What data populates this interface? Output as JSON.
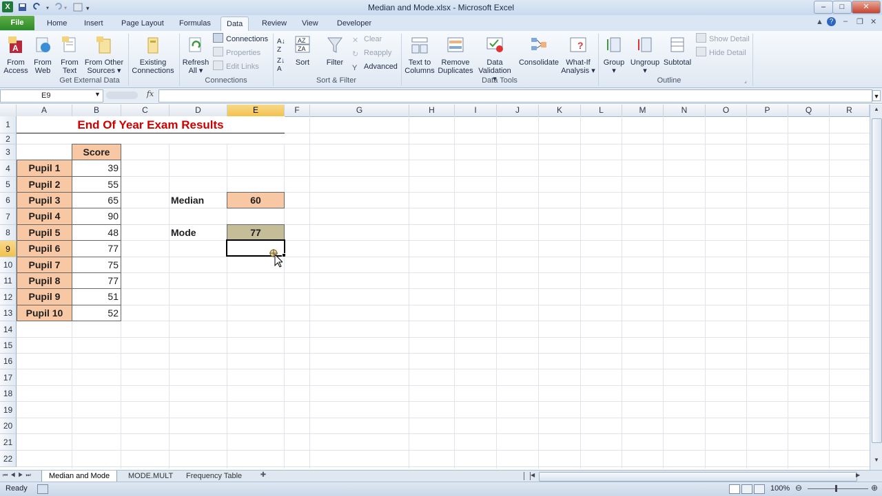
{
  "window": {
    "title": "Median and Mode.xlsx  -  Microsoft Excel"
  },
  "tabs": [
    "File",
    "Home",
    "Insert",
    "Page Layout",
    "Formulas",
    "Data",
    "Review",
    "View",
    "Developer"
  ],
  "active_tab": "Data",
  "ribbon": {
    "get_external": {
      "group_label": "Get External Data",
      "from_access": [
        "From",
        "Access"
      ],
      "from_web": [
        "From",
        "Web"
      ],
      "from_text": [
        "From",
        "Text"
      ],
      "from_other": [
        "From Other",
        "Sources ▾"
      ],
      "existing": [
        "Existing",
        "Connections"
      ]
    },
    "connections": {
      "group_label": "Connections",
      "refresh": [
        "Refresh",
        "All ▾"
      ],
      "connections": "Connections",
      "properties": "Properties",
      "edit_links": "Edit Links"
    },
    "sort_filter": {
      "group_label": "Sort & Filter",
      "sort": "Sort",
      "filter": "Filter",
      "clear": "Clear",
      "reapply": "Reapply",
      "advanced": "Advanced"
    },
    "data_tools": {
      "group_label": "Data Tools",
      "text_to_columns": [
        "Text to",
        "Columns"
      ],
      "remove_duplicates": [
        "Remove",
        "Duplicates"
      ],
      "data_validation": [
        "Data",
        "Validation ▾"
      ],
      "consolidate": "Consolidate",
      "what_if": [
        "What-If",
        "Analysis ▾"
      ]
    },
    "outline": {
      "group_label": "Outline",
      "group": [
        "Group",
        "▾"
      ],
      "ungroup": [
        "Ungroup",
        "▾"
      ],
      "subtotal": "Subtotal",
      "show_detail": "Show Detail",
      "hide_detail": "Hide Detail"
    }
  },
  "formula_bar": {
    "name_box": "E9",
    "fx": "fx",
    "formula": ""
  },
  "columns": [
    "A",
    "B",
    "C",
    "D",
    "E",
    "F",
    "G",
    "H",
    "I",
    "J",
    "K",
    "L",
    "M",
    "N",
    "O",
    "P",
    "Q",
    "R"
  ],
  "rows": [
    "1",
    "2",
    "3",
    "4",
    "5",
    "6",
    "7",
    "8",
    "9",
    "10",
    "11",
    "12",
    "13",
    "14",
    "15",
    "16",
    "17",
    "18",
    "19",
    "20",
    "21",
    "22"
  ],
  "sheet": {
    "title": "End Of Year Exam Results",
    "score_header": "Score",
    "pupils": [
      {
        "name": "Pupil 1",
        "score": "39"
      },
      {
        "name": "Pupil 2",
        "score": "55"
      },
      {
        "name": "Pupil 3",
        "score": "65"
      },
      {
        "name": "Pupil 4",
        "score": "90"
      },
      {
        "name": "Pupil 5",
        "score": "48"
      },
      {
        "name": "Pupil 6",
        "score": "77"
      },
      {
        "name": "Pupil 7",
        "score": "75"
      },
      {
        "name": "Pupil 8",
        "score": "77"
      },
      {
        "name": "Pupil 9",
        "score": "51"
      },
      {
        "name": "Pupil 10",
        "score": "52"
      }
    ],
    "median_label": "Median",
    "median_value": "60",
    "mode_label": "Mode",
    "mode_value": "77"
  },
  "sheet_tabs": [
    "Median and Mode",
    "MODE.MULT",
    "Frequency Table"
  ],
  "status": {
    "ready": "Ready",
    "zoom": "100%"
  },
  "colors": {
    "title_red": "#d00000",
    "peach": "#f8c8a4",
    "mode_fill": "#c4bd97",
    "selected_header": "#f2c24c"
  }
}
